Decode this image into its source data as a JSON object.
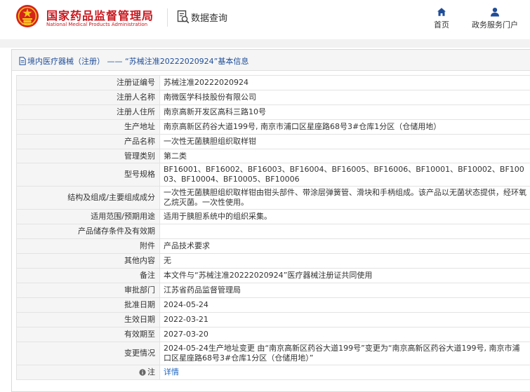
{
  "header": {
    "brand_cn": "国家药品监督管理局",
    "brand_en": "National Medical Products Administration",
    "query_label": "数据查询",
    "nav": [
      {
        "label": "首页",
        "icon": "home-icon"
      },
      {
        "label": "政务服务门户",
        "icon": "user-icon"
      }
    ]
  },
  "breadcrumb": {
    "category": "境内医疗器械（注册）",
    "separator": "——",
    "subject": "“苏械注准20222020924”基本信息"
  },
  "rows": [
    {
      "label": "注册证编号",
      "value": "苏械注准20222020924"
    },
    {
      "label": "注册人名称",
      "value": "南微医学科技股份有限公司"
    },
    {
      "label": "注册人住所",
      "value": "南京高新开发区高科三路10号"
    },
    {
      "label": "生产地址",
      "value": "南京高新区药谷大道199号, 南京市浦口区星座路68号3#仓库1分区（仓储用地）"
    },
    {
      "label": "产品名称",
      "value": "一次性无菌胰胆组织取样钳"
    },
    {
      "label": "管理类别",
      "value": "第二类"
    },
    {
      "label": "型号规格",
      "value": "BF16001、BF16002、BF16003、BF16004、BF16005、BF16006、BF10001、BF10002、BF10003、BF10004、BF10005、BF10006"
    },
    {
      "label": "结构及组成/主要组成成分",
      "value": "一次性无菌胰胆组织取样钳由钳头部件、带涂层弹簧管、滑块和手柄组成。该产品以无菌状态提供，经环氧乙烷灭菌。一次性使用。"
    },
    {
      "label": "适用范围/预期用途",
      "value": "适用于胰胆系统中的组织采集。"
    },
    {
      "label": "产品储存条件及有效期",
      "value": ""
    },
    {
      "label": "附件",
      "value": "产品技术要求"
    },
    {
      "label": "其他内容",
      "value": "无"
    },
    {
      "label": "备注",
      "value": "本文件与“苏械注准20222020924”医疗器械注册证共同使用"
    },
    {
      "label": "审批部门",
      "value": "江苏省药品监督管理局"
    },
    {
      "label": "批准日期",
      "value": "2024-05-24"
    },
    {
      "label": "生效日期",
      "value": "2022-03-21"
    },
    {
      "label": "有效期至",
      "value": "2027-03-20"
    },
    {
      "label": "变更情况",
      "value": "2024-05-24生产地址变更 由“南京高新区药谷大道199号”变更为“南京高新区药谷大道199号, 南京市浦口区星座路68号3#仓库1分区（仓储用地）”"
    }
  ],
  "note": {
    "label": "注",
    "link_text": "详情",
    "icon": "info-icon"
  },
  "colors": {
    "brand_red": "#c9161d",
    "nav_blue": "#1f4e99",
    "link_blue": "#1f66c1"
  }
}
